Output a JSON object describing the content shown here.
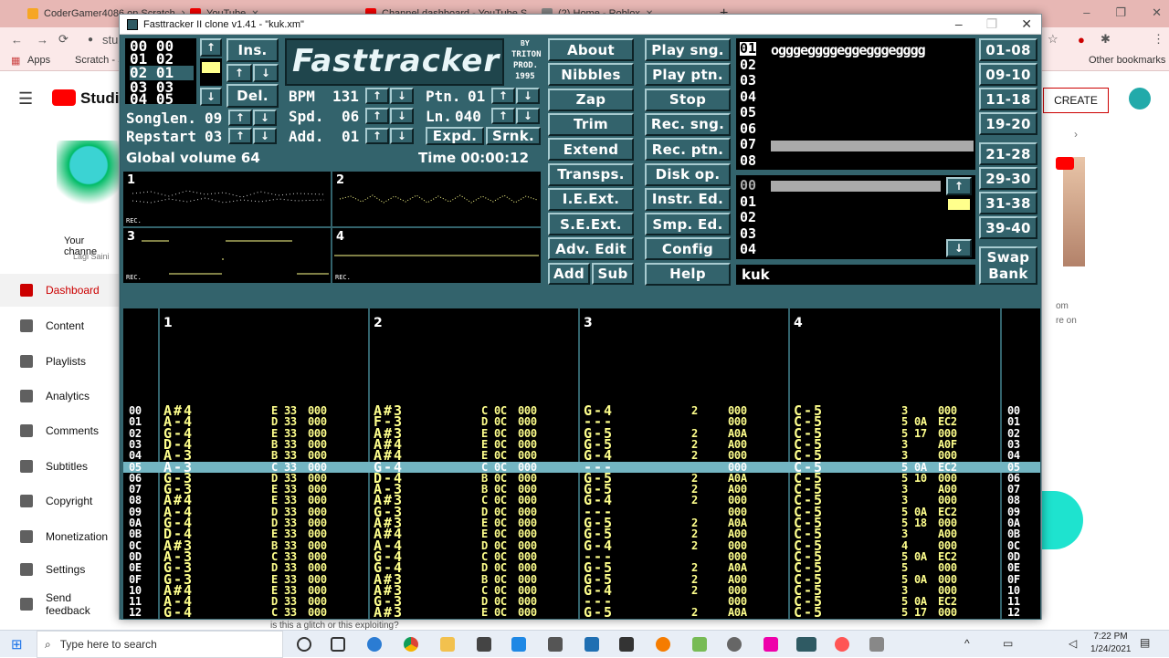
{
  "browser": {
    "tabs": [
      {
        "label": "CoderGamer4086 on Scratch",
        "color": "#f6a623"
      },
      {
        "label": "YouTube",
        "color": "#ff0000"
      },
      {
        "label": "Channel dashboard - YouTube S",
        "color": "#ff0000"
      },
      {
        "label": "(2) Home - Roblox",
        "color": "#888888"
      }
    ],
    "new_tab": "+",
    "window_controls": [
      "–",
      "❐",
      "✕"
    ],
    "address_prefix": "stu",
    "bookmarks": {
      "apps": "Apps",
      "scratch": "Scratch - S",
      "other": "Other bookmarks"
    }
  },
  "youtube": {
    "logo": "Studio",
    "create_button": "CREATE",
    "channel_label": "Your channe",
    "channel_name": "Lagi Saini",
    "sidebar": [
      {
        "label": "Dashboard"
      },
      {
        "label": "Content"
      },
      {
        "label": "Playlists"
      },
      {
        "label": "Analytics"
      },
      {
        "label": "Comments"
      },
      {
        "label": "Subtitles"
      },
      {
        "label": "Copyright"
      },
      {
        "label": "Monetization"
      },
      {
        "label": "Settings"
      },
      {
        "label": "Send feedback"
      }
    ],
    "right_text_1": "om",
    "right_text_2": "re on",
    "bottom_text": "is this a glitch or this exploiting?"
  },
  "ft": {
    "title": "Fasttracker II clone v1.41 - \"kuk.xm\"",
    "logo": "Fasttracker",
    "credit": [
      "BY",
      "TRITON",
      "PROD.",
      "1995"
    ],
    "position_lines": [
      "00 00",
      "01 02",
      "02 01",
      "03 03",
      "04 05"
    ],
    "ins": "Ins.",
    "del": "Del.",
    "songlen_label": "Songlen.",
    "songlen_value": "09",
    "repstart_label": "Repstart",
    "repstart_value": "03",
    "bpm_label": "BPM",
    "bpm_value": "131",
    "spd_label": "Spd.",
    "spd_value": "06",
    "add_label": "Add.",
    "add_value": "01",
    "ptn_label": "Ptn.",
    "ptn_value": "01",
    "ln_label": "Ln.",
    "ln_value": "040",
    "expd": "Expd.",
    "srnk": "Srnk.",
    "up": "↑",
    "down": "↓",
    "global_volume": "Global volume 64",
    "time": "Time 00:00:12",
    "menu_col1": [
      "About",
      "Nibbles",
      "Zap",
      "Trim",
      "Extend",
      "Transps.",
      "I.E.Ext.",
      "S.E.Ext.",
      "Adv. Edit"
    ],
    "add_btn": "Add",
    "sub_btn": "Sub",
    "menu_col2": [
      "Play sng.",
      "Play ptn.",
      "Stop",
      "Rec. sng.",
      "Rec. ptn.",
      "Disk op.",
      "Instr. Ed.",
      "Smp. Ed.",
      "Config",
      "Help"
    ],
    "instrument_numbers": [
      "01",
      "02",
      "03",
      "04",
      "05",
      "06",
      "07",
      "08"
    ],
    "instrument_name": "ogggeggggeggegggegggg",
    "sample_numbers": [
      "00",
      "01",
      "02",
      "03",
      "04"
    ],
    "song_name": "kuk",
    "bank_buttons": [
      "01-08",
      "09-10",
      "11-18",
      "19-20",
      "21-28",
      "29-30",
      "31-38",
      "39-40"
    ],
    "swap_bank": [
      "Swap",
      "Bank"
    ],
    "scopes": [
      {
        "label": "1",
        "rec": "REC."
      },
      {
        "label": "2",
        "rec": ""
      },
      {
        "label": "3",
        "rec": "REC."
      },
      {
        "label": "4",
        "rec": "REC."
      }
    ],
    "channels": [
      "1",
      "2",
      "3",
      "4"
    ],
    "pattern_rows": [
      {
        "n": "00",
        "c1": [
          "A#4",
          "E",
          "33",
          "000"
        ],
        "c2": [
          "A#3",
          "C",
          "0C",
          "000"
        ],
        "c3": [
          "G-4",
          "2",
          "",
          "000"
        ],
        "c4": [
          "C-5",
          "3",
          "",
          "000"
        ]
      },
      {
        "n": "01",
        "c1": [
          "A-4",
          "D",
          "33",
          "000"
        ],
        "c2": [
          "F-3",
          "D",
          "0C",
          "000"
        ],
        "c3": [
          "---",
          "",
          "",
          "000"
        ],
        "c4": [
          "C-5",
          "5",
          "0A",
          "EC2"
        ]
      },
      {
        "n": "02",
        "c1": [
          "G-4",
          "E",
          "33",
          "000"
        ],
        "c2": [
          "A#3",
          "E",
          "0C",
          "000"
        ],
        "c3": [
          "G-5",
          "2",
          "",
          "A0A"
        ],
        "c4": [
          "C-5",
          "5",
          "17",
          "000"
        ]
      },
      {
        "n": "03",
        "c1": [
          "D-4",
          "B",
          "33",
          "000"
        ],
        "c2": [
          "A#4",
          "E",
          "0C",
          "000"
        ],
        "c3": [
          "G-5",
          "2",
          "",
          "A00"
        ],
        "c4": [
          "C-5",
          "3",
          "",
          "A0F"
        ]
      },
      {
        "n": "04",
        "c1": [
          "A-3",
          "B",
          "33",
          "000"
        ],
        "c2": [
          "A#4",
          "E",
          "0C",
          "000"
        ],
        "c3": [
          "G-4",
          "2",
          "",
          "000"
        ],
        "c4": [
          "C-5",
          "3",
          "",
          "000"
        ]
      },
      {
        "n": "05",
        "c1": [
          "A-3",
          "C",
          "33",
          "000"
        ],
        "c2": [
          "G-4",
          "C",
          "0C",
          "000"
        ],
        "c3": [
          "---",
          "",
          "",
          "000"
        ],
        "c4": [
          "C-5",
          "5",
          "0A",
          "EC2"
        ]
      },
      {
        "n": "06",
        "c1": [
          "G-3",
          "D",
          "33",
          "000"
        ],
        "c2": [
          "D-4",
          "B",
          "0C",
          "000"
        ],
        "c3": [
          "G-5",
          "2",
          "",
          "A0A"
        ],
        "c4": [
          "C-5",
          "5",
          "10",
          "000"
        ]
      },
      {
        "n": "07",
        "c1": [
          "G-3",
          "E",
          "33",
          "000"
        ],
        "c2": [
          "A-3",
          "B",
          "0C",
          "000"
        ],
        "c3": [
          "G-5",
          "2",
          "",
          "A00"
        ],
        "c4": [
          "C-5",
          "3",
          "",
          "A00"
        ]
      },
      {
        "n": "08",
        "c1": [
          "A#4",
          "E",
          "33",
          "000"
        ],
        "c2": [
          "A#3",
          "C",
          "0C",
          "000"
        ],
        "c3": [
          "G-4",
          "2",
          "",
          "000"
        ],
        "c4": [
          "C-5",
          "3",
          "",
          "000"
        ]
      },
      {
        "n": "09",
        "c1": [
          "A-4",
          "D",
          "33",
          "000"
        ],
        "c2": [
          "G-3",
          "D",
          "0C",
          "000"
        ],
        "c3": [
          "---",
          "",
          "",
          "000"
        ],
        "c4": [
          "C-5",
          "5",
          "0A",
          "EC2"
        ]
      },
      {
        "n": "0A",
        "c1": [
          "G-4",
          "D",
          "33",
          "000"
        ],
        "c2": [
          "A#3",
          "E",
          "0C",
          "000"
        ],
        "c3": [
          "G-5",
          "2",
          "",
          "A0A"
        ],
        "c4": [
          "C-5",
          "5",
          "18",
          "000"
        ]
      },
      {
        "n": "0B",
        "c1": [
          "D-4",
          "E",
          "33",
          "000"
        ],
        "c2": [
          "A#4",
          "E",
          "0C",
          "000"
        ],
        "c3": [
          "G-5",
          "2",
          "",
          "A00"
        ],
        "c4": [
          "C-5",
          "3",
          "",
          "A00"
        ]
      },
      {
        "n": "0C",
        "c1": [
          "A#3",
          "B",
          "33",
          "000"
        ],
        "c2": [
          "A-4",
          "D",
          "0C",
          "000"
        ],
        "c3": [
          "G-4",
          "2",
          "",
          "000"
        ],
        "c4": [
          "C-5",
          "4",
          "",
          "000"
        ]
      },
      {
        "n": "0D",
        "c1": [
          "A-3",
          "C",
          "33",
          "000"
        ],
        "c2": [
          "G-4",
          "C",
          "0C",
          "000"
        ],
        "c3": [
          "---",
          "",
          "",
          "000"
        ],
        "c4": [
          "C-5",
          "5",
          "0A",
          "EC2"
        ]
      },
      {
        "n": "0E",
        "c1": [
          "G-3",
          "D",
          "33",
          "000"
        ],
        "c2": [
          "G-4",
          "D",
          "0C",
          "000"
        ],
        "c3": [
          "G-5",
          "2",
          "",
          "A0A"
        ],
        "c4": [
          "C-5",
          "5",
          "",
          "000"
        ]
      },
      {
        "n": "0F",
        "c1": [
          "G-3",
          "E",
          "33",
          "000"
        ],
        "c2": [
          "A#3",
          "B",
          "0C",
          "000"
        ],
        "c3": [
          "G-5",
          "2",
          "",
          "A00"
        ],
        "c4": [
          "C-5",
          "5",
          "0A",
          "000"
        ]
      },
      {
        "n": "10",
        "c1": [
          "A#4",
          "E",
          "33",
          "000"
        ],
        "c2": [
          "A#3",
          "C",
          "0C",
          "000"
        ],
        "c3": [
          "G-4",
          "2",
          "",
          "000"
        ],
        "c4": [
          "C-5",
          "3",
          "",
          "000"
        ]
      },
      {
        "n": "11",
        "c1": [
          "A-4",
          "D",
          "33",
          "000"
        ],
        "c2": [
          "G-3",
          "D",
          "0C",
          "000"
        ],
        "c3": [
          "---",
          "",
          "",
          "000"
        ],
        "c4": [
          "C-5",
          "5",
          "0A",
          "EC2"
        ]
      },
      {
        "n": "12",
        "c1": [
          "G-4",
          "C",
          "33",
          "000"
        ],
        "c2": [
          "A#3",
          "E",
          "0C",
          "000"
        ],
        "c3": [
          "G-5",
          "2",
          "",
          "A0A"
        ],
        "c4": [
          "C-5",
          "5",
          "17",
          "000"
        ]
      }
    ]
  },
  "taskbar": {
    "search": "Type here to search",
    "time": "7:22 PM",
    "date": "1/24/2021"
  }
}
